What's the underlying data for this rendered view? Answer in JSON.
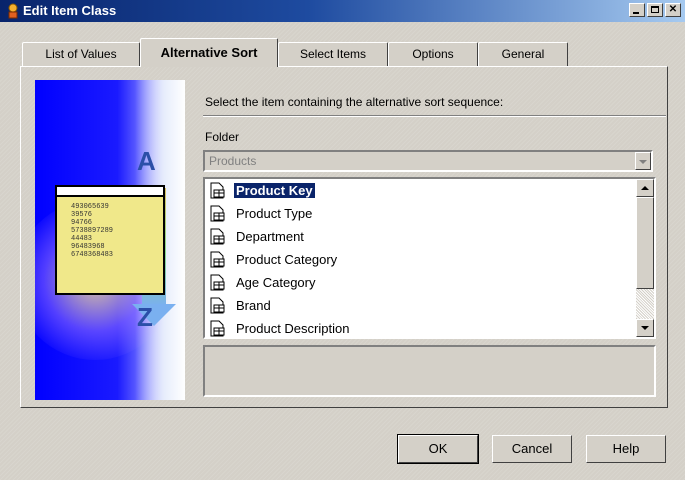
{
  "window": {
    "title": "Edit Item Class",
    "icon": "item-class-icon",
    "controls": [
      "minimize-icon",
      "maximize-icon",
      "close-icon"
    ]
  },
  "tabs": [
    {
      "label": "List of Values",
      "active": false
    },
    {
      "label": "Alternative Sort",
      "active": true
    },
    {
      "label": "Select Items",
      "active": false
    },
    {
      "label": "Options",
      "active": false
    },
    {
      "label": "General",
      "active": false
    }
  ],
  "illustration": {
    "letter_top": "A",
    "letter_bottom": "Z",
    "card_lines": [
      "493065639",
      "39576",
      "94766",
      "5738897289",
      "44483",
      "96483968",
      "6748368483"
    ]
  },
  "content": {
    "instruction": "Select the item containing the alternative sort sequence:",
    "folder_label": "Folder",
    "folder_value": "Products",
    "items": [
      {
        "label": "Product Key",
        "selected": true
      },
      {
        "label": "Product Type",
        "selected": false
      },
      {
        "label": "Department",
        "selected": false
      },
      {
        "label": "Product Category",
        "selected": false
      },
      {
        "label": "Age Category",
        "selected": false
      },
      {
        "label": "Brand",
        "selected": false
      },
      {
        "label": "Product Description",
        "selected": false
      }
    ]
  },
  "buttons": {
    "ok": "OK",
    "cancel": "Cancel",
    "help": "Help"
  },
  "colors": {
    "title_bar": "#08246b",
    "selection": "#0a246a",
    "face": "#d4d0c8"
  }
}
